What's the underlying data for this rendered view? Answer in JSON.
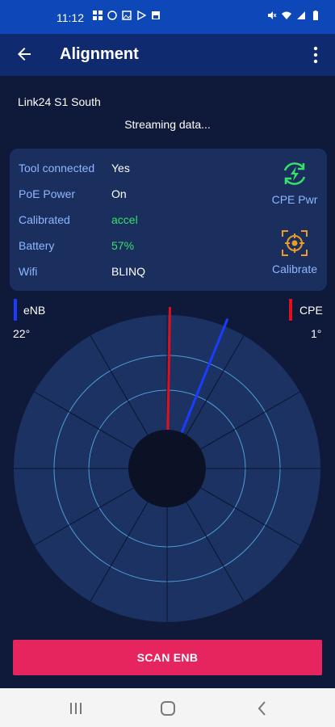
{
  "status_bar": {
    "time": "11:12",
    "left_icons": [
      "grid-icon",
      "whatsapp-icon",
      "image-icon",
      "play-store-icon",
      "save-icon"
    ],
    "right_icons": [
      "mute-icon",
      "wifi-icon",
      "signal-icon",
      "battery-icon"
    ]
  },
  "app_bar": {
    "title": "Alignment"
  },
  "link": {
    "name": "Link24 S1 South",
    "status": "Streaming data..."
  },
  "info": {
    "rows": [
      {
        "label": "Tool connected",
        "value": "Yes"
      },
      {
        "label": "PoE Power",
        "value": "On"
      },
      {
        "label": "Calibrated",
        "value": "accel"
      },
      {
        "label": "Battery",
        "value": "57%"
      },
      {
        "label": "Wifi",
        "value": "BLINQ"
      }
    ],
    "cpe_pwr_label": "CPE Pwr",
    "calibrate_label": "Calibrate"
  },
  "radar": {
    "enb_label": "eNB",
    "enb_degree": "22°",
    "cpe_label": "CPE",
    "cpe_degree": "1°",
    "enb_angle": 22,
    "cpe_angle": 1,
    "colors": {
      "enb": "#1a3cff",
      "cpe": "#e0101e",
      "grid": "#4aa0d8",
      "fill": "#1c3262"
    }
  },
  "scan_button": {
    "label": "SCAN ENB"
  },
  "colors": {
    "accent": "#e6245e",
    "statusbar": "#0d47b8",
    "appbar": "#0f2a6e",
    "background": "#0f1a3a"
  }
}
